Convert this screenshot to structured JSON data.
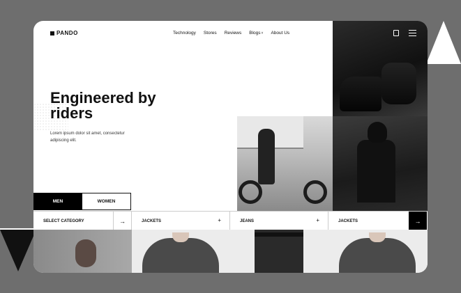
{
  "brand": {
    "name": "PANDO"
  },
  "nav": [
    "Technology",
    "Stores",
    "Reviews",
    "Blogs",
    "About Us"
  ],
  "nav_dropdown_indicator": "˅",
  "hero": {
    "title": "Engineered by riders",
    "subtitle": "Lorem ipsum dolor sit amet, consectetur adipiscing elit."
  },
  "tabs": {
    "men": "MEN",
    "women": "WOMEN",
    "active": "MEN"
  },
  "filters": {
    "select_category": "SELECT CATEGORY",
    "arrow": "→",
    "items": [
      "JACKETS",
      "JEANS",
      "JACKETS"
    ],
    "plus": "+"
  },
  "icons": {
    "cart": "cart-icon",
    "menu": "hamburger-menu-icon",
    "logo": "pando-logo-mark"
  }
}
